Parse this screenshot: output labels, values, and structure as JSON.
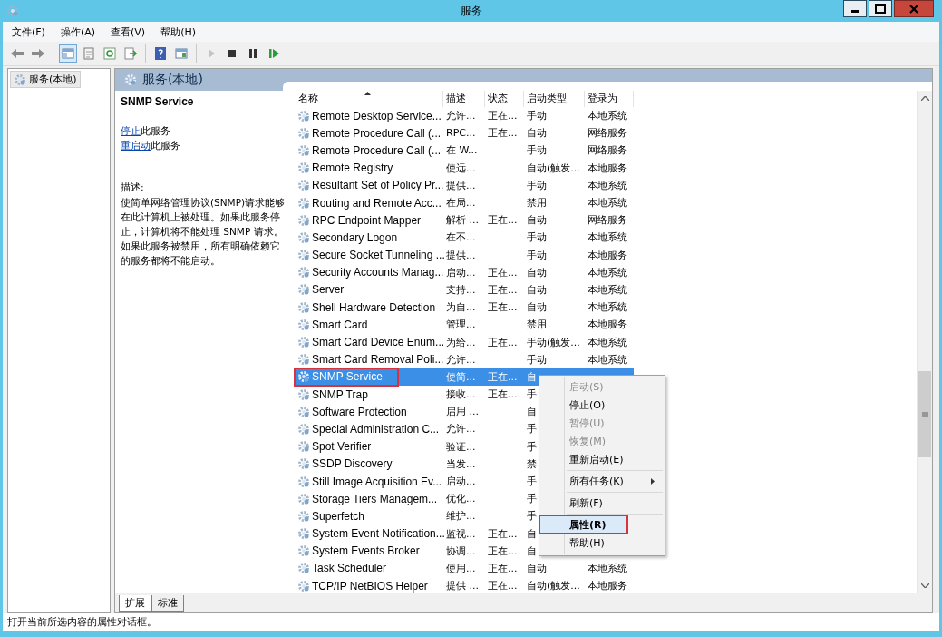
{
  "window": {
    "title": "服务"
  },
  "menu_bar": [
    "文件(F)",
    "操作(A)",
    "查看(V)",
    "帮助(H)"
  ],
  "toolbar": [
    {
      "kind": "back",
      "disabled": false,
      "pressed": false
    },
    {
      "kind": "forward",
      "disabled": false,
      "pressed": false
    },
    {
      "kind": "separator"
    },
    {
      "kind": "tree",
      "disabled": false,
      "pressed": true
    },
    {
      "kind": "properties",
      "disabled": false,
      "pressed": false
    },
    {
      "kind": "refresh",
      "disabled": false,
      "pressed": false
    },
    {
      "kind": "export",
      "disabled": false,
      "pressed": false
    },
    {
      "kind": "separator"
    },
    {
      "kind": "help",
      "disabled": false,
      "pressed": false
    },
    {
      "kind": "view",
      "disabled": false,
      "pressed": false
    },
    {
      "kind": "separator"
    },
    {
      "kind": "start",
      "disabled": true,
      "pressed": false
    },
    {
      "kind": "stop",
      "disabled": false,
      "pressed": false
    },
    {
      "kind": "pause",
      "disabled": false,
      "pressed": false
    },
    {
      "kind": "resume",
      "disabled": false,
      "pressed": false
    }
  ],
  "tree": [
    {
      "label": "服务(本地)",
      "selected": true
    }
  ],
  "panel": {
    "title": "服务(本地)"
  },
  "details": {
    "service_name": "SNMP Service",
    "actions": [
      {
        "link": "停止",
        "text": "此服务"
      },
      {
        "link": "重启动",
        "text": "此服务"
      }
    ],
    "description_label": "描述:",
    "description": "使简单网络管理协议(SNMP)请求能够在此计算机上被处理。如果此服务停止，计算机将不能处理 SNMP 请求。如果此服务被禁用，所有明确依赖它的服务都将不能启动。"
  },
  "table": {
    "columns": [
      {
        "label": "名称",
        "sorted": true
      },
      {
        "label": "描述",
        "sorted": false
      },
      {
        "label": "状态",
        "sorted": false
      },
      {
        "label": "启动类型",
        "sorted": false
      },
      {
        "label": "登录为",
        "sorted": false
      }
    ],
    "rows": [
      {
        "name": "Remote Desktop Service...",
        "description": "允许...",
        "status": "正在...",
        "startup": "手动",
        "logon": "本地系统",
        "selected": false,
        "highlighted": false
      },
      {
        "name": "Remote Procedure Call (...",
        "description": "RPC...",
        "status": "正在...",
        "startup": "自动",
        "logon": "网络服务",
        "selected": false,
        "highlighted": false
      },
      {
        "name": "Remote Procedure Call (...",
        "description": "在 W...",
        "startup": "手动",
        "logon": "网络服务",
        "selected": false,
        "highlighted": false
      },
      {
        "name": "Remote Registry",
        "description": "使远...",
        "startup": "自动(触发...",
        "logon": "本地服务",
        "selected": false,
        "highlighted": false
      },
      {
        "name": "Resultant Set of Policy Pr...",
        "description": "提供...",
        "startup": "手动",
        "logon": "本地系统",
        "selected": false,
        "highlighted": false
      },
      {
        "name": "Routing and Remote Acc...",
        "description": "在局...",
        "startup": "禁用",
        "logon": "本地系统",
        "selected": false,
        "highlighted": false
      },
      {
        "name": "RPC Endpoint Mapper",
        "description": "解析 ...",
        "status": "正在...",
        "startup": "自动",
        "logon": "网络服务",
        "selected": false,
        "highlighted": false
      },
      {
        "name": "Secondary Logon",
        "description": "在不...",
        "startup": "手动",
        "logon": "本地系统",
        "selected": false,
        "highlighted": false
      },
      {
        "name": "Secure Socket Tunneling ...",
        "description": "提供...",
        "startup": "手动",
        "logon": "本地服务",
        "selected": false,
        "highlighted": false
      },
      {
        "name": "Security Accounts Manag...",
        "description": "启动...",
        "status": "正在...",
        "startup": "自动",
        "logon": "本地系统",
        "selected": false,
        "highlighted": false
      },
      {
        "name": "Server",
        "description": "支持...",
        "status": "正在...",
        "startup": "自动",
        "logon": "本地系统",
        "selected": false,
        "highlighted": false
      },
      {
        "name": "Shell Hardware Detection",
        "description": "为自...",
        "status": "正在...",
        "startup": "自动",
        "logon": "本地系统",
        "selected": false,
        "highlighted": false
      },
      {
        "name": "Smart Card",
        "description": "管理...",
        "startup": "禁用",
        "logon": "本地服务",
        "selected": false,
        "highlighted": false
      },
      {
        "name": "Smart Card Device Enum...",
        "description": "为给...",
        "status": "正在...",
        "startup": "手动(触发...",
        "logon": "本地系统",
        "selected": false,
        "highlighted": false
      },
      {
        "name": "Smart Card Removal Poli...",
        "description": "允许...",
        "startup": "手动",
        "logon": "本地系统",
        "selected": false,
        "highlighted": false
      },
      {
        "name": "SNMP Service",
        "description": "使简...",
        "status": "正在...",
        "startup": "自",
        "selected": true,
        "highlighted": true
      },
      {
        "name": "SNMP Trap",
        "description": "接收...",
        "status": "正在...",
        "startup": "手",
        "selected": false,
        "highlighted": false
      },
      {
        "name": "Software Protection",
        "description": "启用 ...",
        "startup": "自",
        "selected": false,
        "highlighted": false
      },
      {
        "name": "Special Administration C...",
        "description": "允许...",
        "startup": "手",
        "selected": false,
        "highlighted": false
      },
      {
        "name": "Spot Verifier",
        "description": "验证...",
        "startup": "手",
        "selected": false,
        "highlighted": false
      },
      {
        "name": "SSDP Discovery",
        "description": "当发...",
        "startup": "禁",
        "selected": false,
        "highlighted": false
      },
      {
        "name": "Still Image Acquisition Ev...",
        "description": "启动...",
        "startup": "手",
        "selected": false,
        "highlighted": false
      },
      {
        "name": "Storage Tiers Managem...",
        "description": "优化...",
        "startup": "手",
        "selected": false,
        "highlighted": false
      },
      {
        "name": "Superfetch",
        "description": "维护...",
        "startup": "手",
        "selected": false,
        "highlighted": false
      },
      {
        "name": "System Event Notification...",
        "description": "监视...",
        "status": "正在...",
        "startup": "自",
        "selected": false,
        "highlighted": false
      },
      {
        "name": "System Events Broker",
        "description": "协调...",
        "status": "正在...",
        "startup": "自",
        "selected": false,
        "highlighted": false
      },
      {
        "name": "Task Scheduler",
        "description": "使用...",
        "status": "正在...",
        "startup": "自动",
        "logon": "本地系统",
        "selected": false,
        "highlighted": false
      },
      {
        "name": "TCP/IP NetBIOS Helper",
        "description": "提供 ...",
        "status": "正在...",
        "startup": "自动(触发...",
        "logon": "本地服务",
        "selected": false,
        "highlighted": false
      }
    ]
  },
  "context_menu": {
    "items": [
      {
        "kind": "item",
        "label": "启动(S)",
        "disabled": true,
        "default": false,
        "submenu": false,
        "selected": false,
        "highlighted": false
      },
      {
        "kind": "item",
        "label": "停止(O)",
        "disabled": false,
        "default": false,
        "submenu": false,
        "selected": false,
        "highlighted": false
      },
      {
        "kind": "item",
        "label": "暂停(U)",
        "disabled": true,
        "default": false,
        "submenu": false,
        "selected": false,
        "highlighted": false
      },
      {
        "kind": "item",
        "label": "恢复(M)",
        "disabled": true,
        "default": false,
        "submenu": false,
        "selected": false,
        "highlighted": false
      },
      {
        "kind": "item",
        "label": "重新启动(E)",
        "disabled": false,
        "default": false,
        "submenu": false,
        "selected": false,
        "highlighted": false
      },
      {
        "kind": "separator"
      },
      {
        "kind": "item",
        "label": "所有任务(K)",
        "disabled": false,
        "default": false,
        "submenu": true,
        "selected": false,
        "highlighted": false
      },
      {
        "kind": "separator"
      },
      {
        "kind": "item",
        "label": "刷新(F)",
        "disabled": false,
        "default": false,
        "submenu": false,
        "selected": false,
        "highlighted": false
      },
      {
        "kind": "separator"
      },
      {
        "kind": "item",
        "label": "属性(R)",
        "disabled": false,
        "default": true,
        "submenu": false,
        "selected": true,
        "highlighted": true
      },
      {
        "kind": "item",
        "label": "帮助(H)",
        "disabled": false,
        "default": false,
        "submenu": false,
        "selected": false,
        "highlighted": false
      }
    ]
  },
  "view_tabs": [
    {
      "label": "扩展",
      "selected": true
    },
    {
      "label": "标准",
      "selected": false
    }
  ],
  "status_bar": "打开当前所选内容的属性对话框。"
}
